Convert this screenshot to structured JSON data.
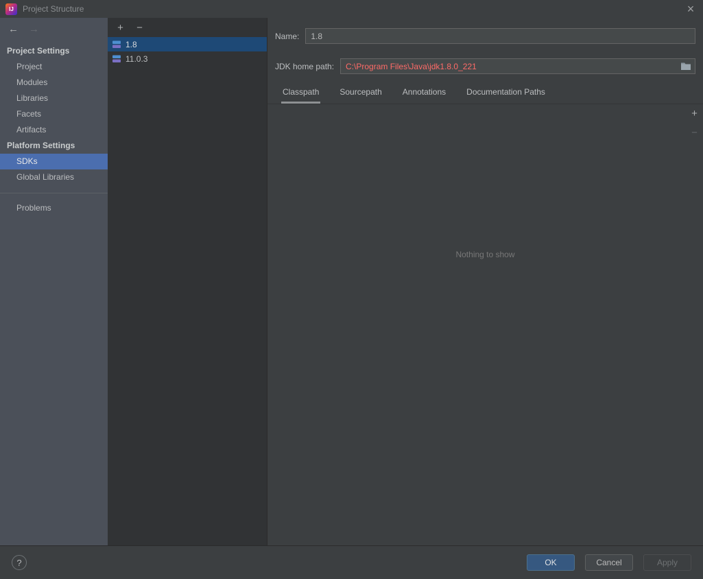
{
  "window": {
    "title": "Project Structure",
    "logo_text": "IJ"
  },
  "icons": {
    "back": "←",
    "forward": "→",
    "add": "+",
    "remove": "−",
    "close": "×",
    "help": "?"
  },
  "sidebar": {
    "sections": [
      {
        "header": "Project Settings",
        "items": [
          {
            "label": "Project",
            "selected": false
          },
          {
            "label": "Modules",
            "selected": false
          },
          {
            "label": "Libraries",
            "selected": false
          },
          {
            "label": "Facets",
            "selected": false
          },
          {
            "label": "Artifacts",
            "selected": false
          }
        ]
      },
      {
        "header": "Platform Settings",
        "items": [
          {
            "label": "SDKs",
            "selected": true
          },
          {
            "label": "Global Libraries",
            "selected": false
          }
        ]
      }
    ],
    "other_items": [
      {
        "label": "Problems",
        "selected": false
      }
    ]
  },
  "sdk_list": {
    "items": [
      {
        "label": "1.8",
        "selected": true
      },
      {
        "label": "11.0.3",
        "selected": false
      }
    ]
  },
  "editor": {
    "name_label": "Name:",
    "name_value": "1.8",
    "jdk_home_label": "JDK home path:",
    "jdk_home_value": "C:\\Program Files\\Java\\jdk1.8.0_221",
    "tabs": [
      {
        "label": "Classpath",
        "selected": true
      },
      {
        "label": "Sourcepath",
        "selected": false
      },
      {
        "label": "Annotations",
        "selected": false
      },
      {
        "label": "Documentation Paths",
        "selected": false
      }
    ],
    "empty_text": "Nothing to show"
  },
  "footer": {
    "buttons": [
      {
        "label": "OK",
        "state": "primary"
      },
      {
        "label": "Cancel",
        "state": "normal"
      },
      {
        "label": "Apply",
        "state": "disabled"
      }
    ]
  },
  "colors": {
    "background": "#3c3f41",
    "sidebar": "#4b5059",
    "panel_dark": "#313335",
    "accent_selection_blue": "#4b6eaf",
    "list_selection_blue": "#1e4976",
    "error_red": "#ff6b68",
    "primary_button_blue": "#365880"
  }
}
